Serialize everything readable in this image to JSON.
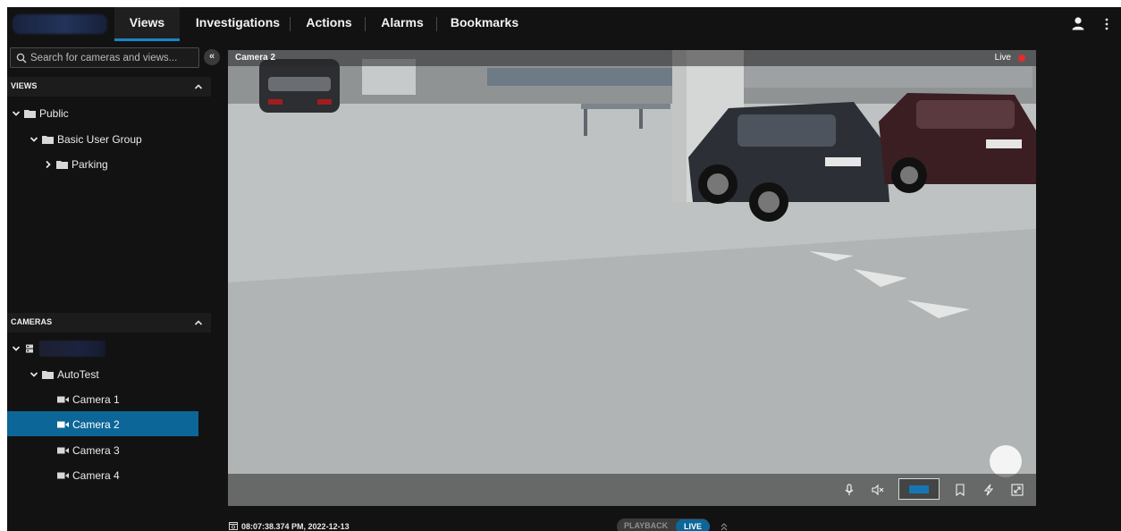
{
  "nav": {
    "tabs": [
      {
        "label": "Views",
        "active": true
      },
      {
        "label": "Investigations",
        "active": false
      },
      {
        "label": "Actions",
        "active": false
      },
      {
        "label": "Alarms",
        "active": false
      },
      {
        "label": "Bookmarks",
        "active": false
      }
    ]
  },
  "search": {
    "placeholder": "Search for cameras and views..."
  },
  "views_section": {
    "title": "VIEWS",
    "items": [
      {
        "label": "Public"
      },
      {
        "label": "Basic User Group"
      },
      {
        "label": "Parking"
      }
    ]
  },
  "cameras_section": {
    "title": "CAMERAS",
    "folder": "AutoTest",
    "cameras": [
      {
        "label": "Camera 1",
        "selected": false
      },
      {
        "label": "Camera 2",
        "selected": true
      },
      {
        "label": "Camera 3",
        "selected": false
      },
      {
        "label": "Camera 4",
        "selected": false
      }
    ]
  },
  "video": {
    "camera_title": "Camera 2",
    "live_label": "Live",
    "controls": [
      "microphone-icon",
      "speaker-muted-icon",
      "stream-selector",
      "bookmark-icon",
      "lightning-icon",
      "fullscreen-icon"
    ]
  },
  "footer": {
    "timestamp": "08:07:38.374 PM, 2022-12-13",
    "playback_label": "PLAYBACK",
    "live_label": "LIVE"
  },
  "colors": {
    "accent": "#1a84c7",
    "selection": "#0d6698",
    "live_dot": "#e62c2c",
    "background": "#121212"
  }
}
